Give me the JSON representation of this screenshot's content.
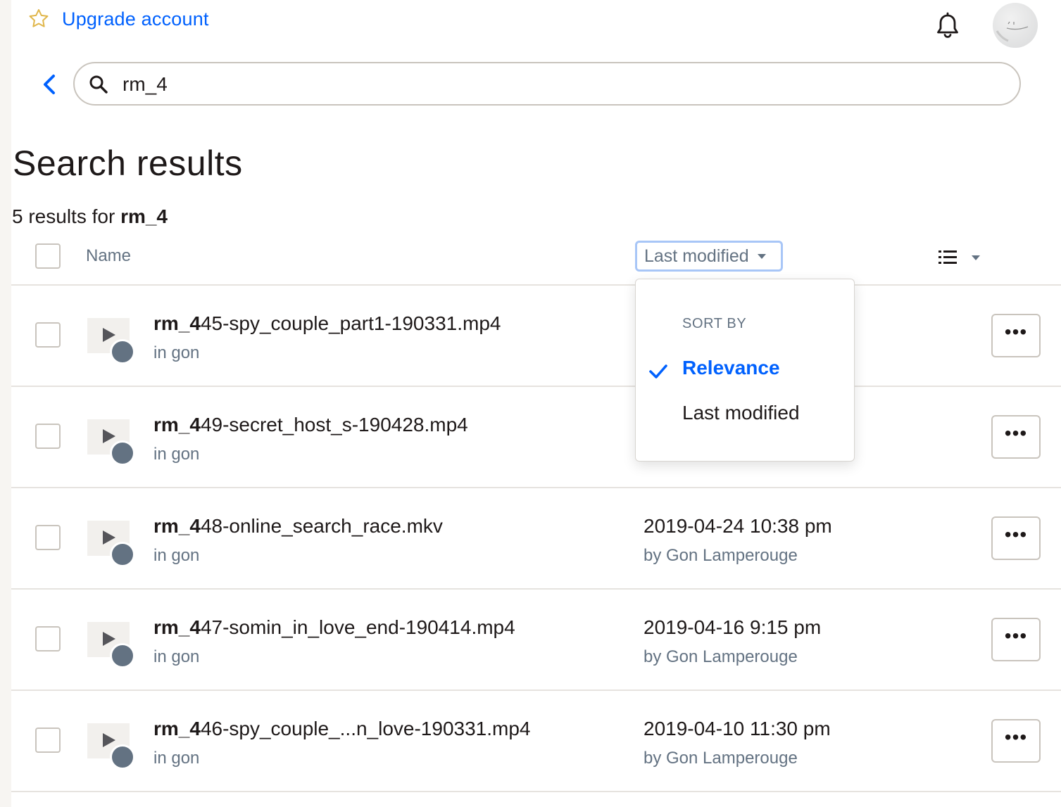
{
  "header": {
    "upgrade_label": "Upgrade account"
  },
  "search": {
    "value": "rm_4"
  },
  "page": {
    "title": "Search results",
    "results_count_text": "5 results for ",
    "results_query": "rm_4"
  },
  "columns": {
    "name": "Name",
    "sort_label": "Last modified"
  },
  "sort_menu": {
    "heading": "SORT BY",
    "options": [
      {
        "label": "Relevance",
        "selected": true
      },
      {
        "label": "Last modified",
        "selected": false
      }
    ]
  },
  "rows": [
    {
      "name_bold": "rm_4",
      "name_rest": "45-spy_couple_part1-190331.mp4",
      "location": "in gon",
      "date": "",
      "by": ""
    },
    {
      "name_bold": "rm_4",
      "name_rest": "49-secret_host_s-190428.mp4",
      "location": "in gon",
      "date": "",
      "by": ""
    },
    {
      "name_bold": "rm_4",
      "name_rest": "48-online_search_race.mkv",
      "location": "in gon",
      "date": "2019-04-24 10:38 pm",
      "by": "by Gon Lamperouge"
    },
    {
      "name_bold": "rm_4",
      "name_rest": "47-somin_in_love_end-190414.mp4",
      "location": "in gon",
      "date": "2019-04-16 9:15 pm",
      "by": "by Gon Lamperouge"
    },
    {
      "name_bold": "rm_4",
      "name_rest": "46-spy_couple_...n_love-190331.mp4",
      "location": "in gon",
      "date": "2019-04-10 11:30 pm",
      "by": "by Gon Lamperouge"
    }
  ],
  "more_label": "•••",
  "colors": {
    "accent": "#0061fe",
    "text": "#1e1919",
    "muted": "#637282",
    "border": "#c9c4bd"
  }
}
